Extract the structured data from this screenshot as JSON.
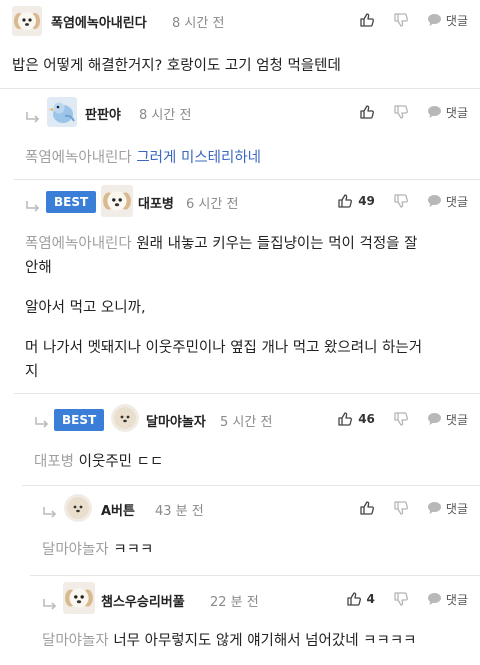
{
  "labels": {
    "reply": "댓글",
    "best": "BEST"
  },
  "colors": {
    "accent": "#3b7ed8",
    "mention": "#a0a0a0",
    "link": "#3b68c2",
    "time": "#8a8a8a"
  },
  "comments": [
    {
      "id": 1,
      "nick": "폭염에녹아내린다",
      "time": "8 시간 전",
      "like_count": "",
      "avatar": "puppy-avatar",
      "body": "밥은 어떻게 해결한거지? 호랑이도 고기 엄청 먹을텐데"
    },
    {
      "id": 2,
      "nick": "판판야",
      "time": "8 시간 전",
      "like_count": "",
      "avatar": "bird-avatar",
      "mention": "폭염에녹아내린다",
      "body": "그러게 미스테리하네"
    },
    {
      "id": 3,
      "best": true,
      "nick": "대포병",
      "time": "6 시간 전",
      "like_count": "49",
      "avatar": "puppy-avatar",
      "mention": "폭염에녹아내린다",
      "body_line1": "원래 내놓고 키우는 들집냥이는 먹이 걱정을 잘",
      "body_line2": "안해",
      "body_para2": "알아서 먹고 오니까,",
      "body_para3_line1": "머 나가서 멧돼지나 이웃주민이나 옆집 개나 먹고 왔으려니 하는거",
      "body_para3_line2": "지"
    },
    {
      "id": 4,
      "best": true,
      "nick": "달마야놀자",
      "time": "5 시간 전",
      "like_count": "46",
      "avatar": "puppy-avatar",
      "mention": "대포병",
      "body": "이웃주민 ㄷㄷ"
    },
    {
      "id": 5,
      "nick": "A버튼",
      "time": "43 분 전",
      "like_count": "",
      "avatar": "puppy-avatar",
      "mention": "달마야놀자",
      "body": "ㅋㅋㅋ"
    },
    {
      "id": 6,
      "nick": "챔스우승리버풀",
      "time": "22 분 전",
      "like_count": "4",
      "avatar": "puppy-avatar",
      "mention": "달마야놀자",
      "body": "너무 아무렇지도 않게 얘기해서 넘어갔네 ㅋㅋㅋㅋ"
    }
  ]
}
